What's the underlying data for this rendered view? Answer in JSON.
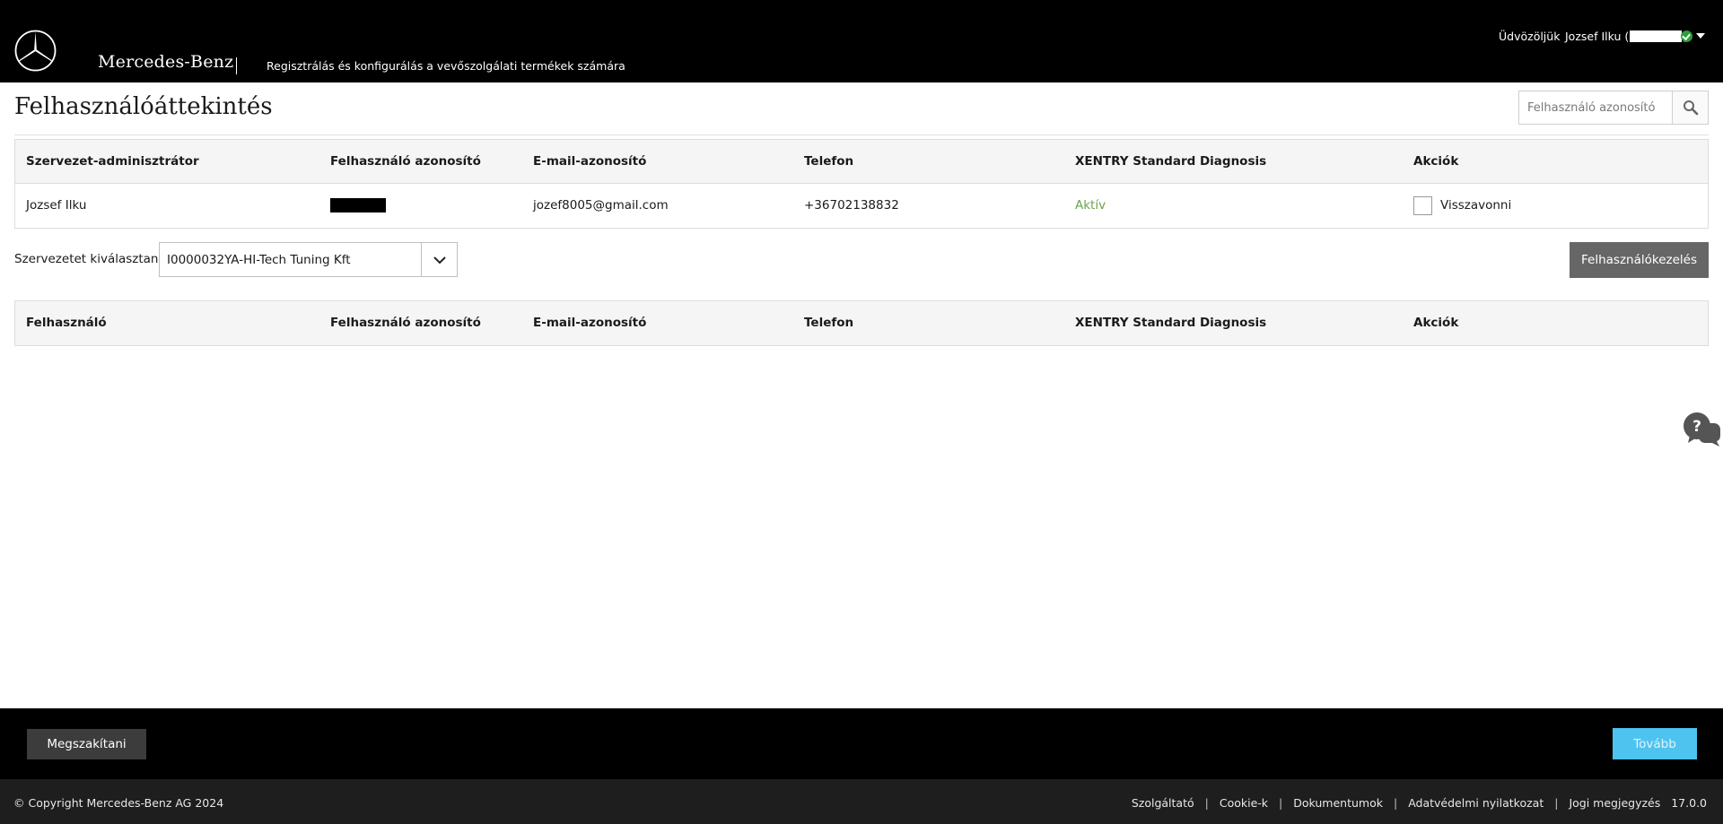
{
  "header": {
    "brand": "Mercedes-Benz",
    "tagline": "Regisztrálás és konfigurálás a vevőszolgálati termékek számára",
    "welcome": "Üdvözöljük",
    "user_prefix": "Jozsef Ilku (",
    "user_suffix": ")",
    "status_color": "#2e9e3a"
  },
  "page": {
    "title": "Felhasználóáttekintés"
  },
  "search": {
    "placeholder": "Felhasználó azonosító",
    "icon": "search-icon"
  },
  "admin_table": {
    "headers": [
      "Szervezet-adminisztrátor",
      "Felhasználó azonosító",
      "E-mail-azonosító",
      "Telefon",
      "XENTRY Standard Diagnosis",
      "Akciók"
    ],
    "row": {
      "name": "Jozsef Ilku",
      "email": "jozef8005@gmail.com",
      "phone": "+36702138832",
      "status": "Aktív",
      "action_label": "Visszavonni"
    }
  },
  "org": {
    "label": "Szervezetet kiválasztani",
    "selected": "I0000032YA-HI-Tech Tuning Kft",
    "manage_button": "Felhasználókezelés"
  },
  "user_table": {
    "headers": [
      "Felhasználó",
      "Felhasználó azonosító",
      "E-mail-azonosító",
      "Telefon",
      "XENTRY Standard Diagnosis",
      "Akciók"
    ]
  },
  "actions": {
    "cancel": "Megszakítani",
    "next": "Tovább"
  },
  "footer": {
    "copyright": "© Copyright Mercedes-Benz AG 2024",
    "links": [
      "Szolgáltató",
      "Cookie-k",
      "Dokumentumok",
      "Adatvédelmi nyilatkozat",
      "Jogi megjegyzés"
    ],
    "separator": "|",
    "version": "17.0.0"
  },
  "colors": {
    "header_bg": "#000000",
    "active_status": "#6aa34d",
    "next_button": "#4fc3ef",
    "manage_button": "#666666"
  }
}
